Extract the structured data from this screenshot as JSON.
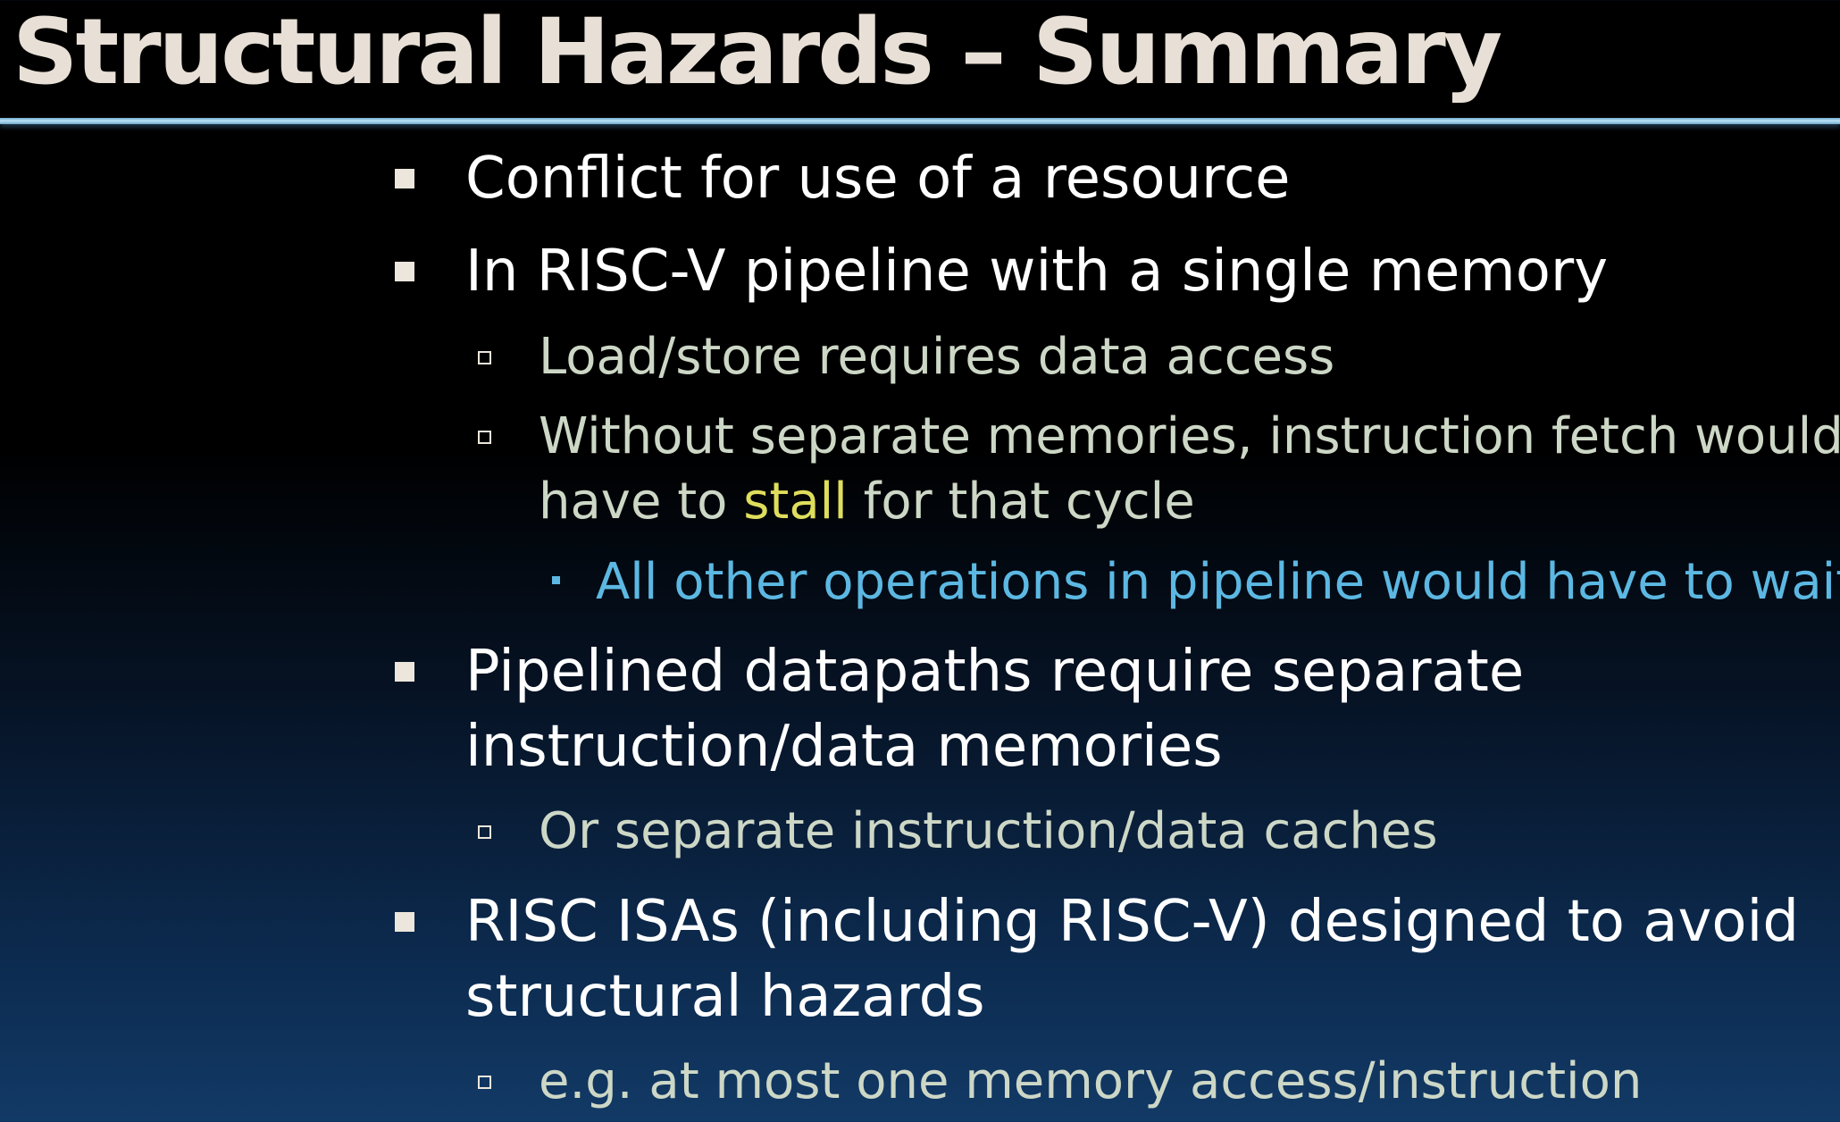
{
  "slide": {
    "title": "Structural Hazards – Summary",
    "bullets": [
      "Conflict for use of a resource",
      "In RISC-V pipeline with a single memory",
      "Load/store requires data access",
      "Without separate memories, instruction fetch would",
      "have to ",
      "stall",
      " for that cycle",
      "All other operations in pipeline would have to wait",
      "Pipelined datapaths require separate",
      "instruction/data memories",
      "Or separate instruction/data caches",
      "RISC ISAs (including RISC-V) designed to avoid",
      "structural hazards",
      "e.g. at most one memory access/instruction"
    ]
  },
  "colors": {
    "title": "#e8e0d6",
    "level1_text": "#ffffff",
    "level2_text": "#cdd7c6",
    "level3_text": "#5cb8e2",
    "highlight": "#dede5c",
    "rule": "#9fd3ee",
    "background_bottom": "#123a66"
  }
}
